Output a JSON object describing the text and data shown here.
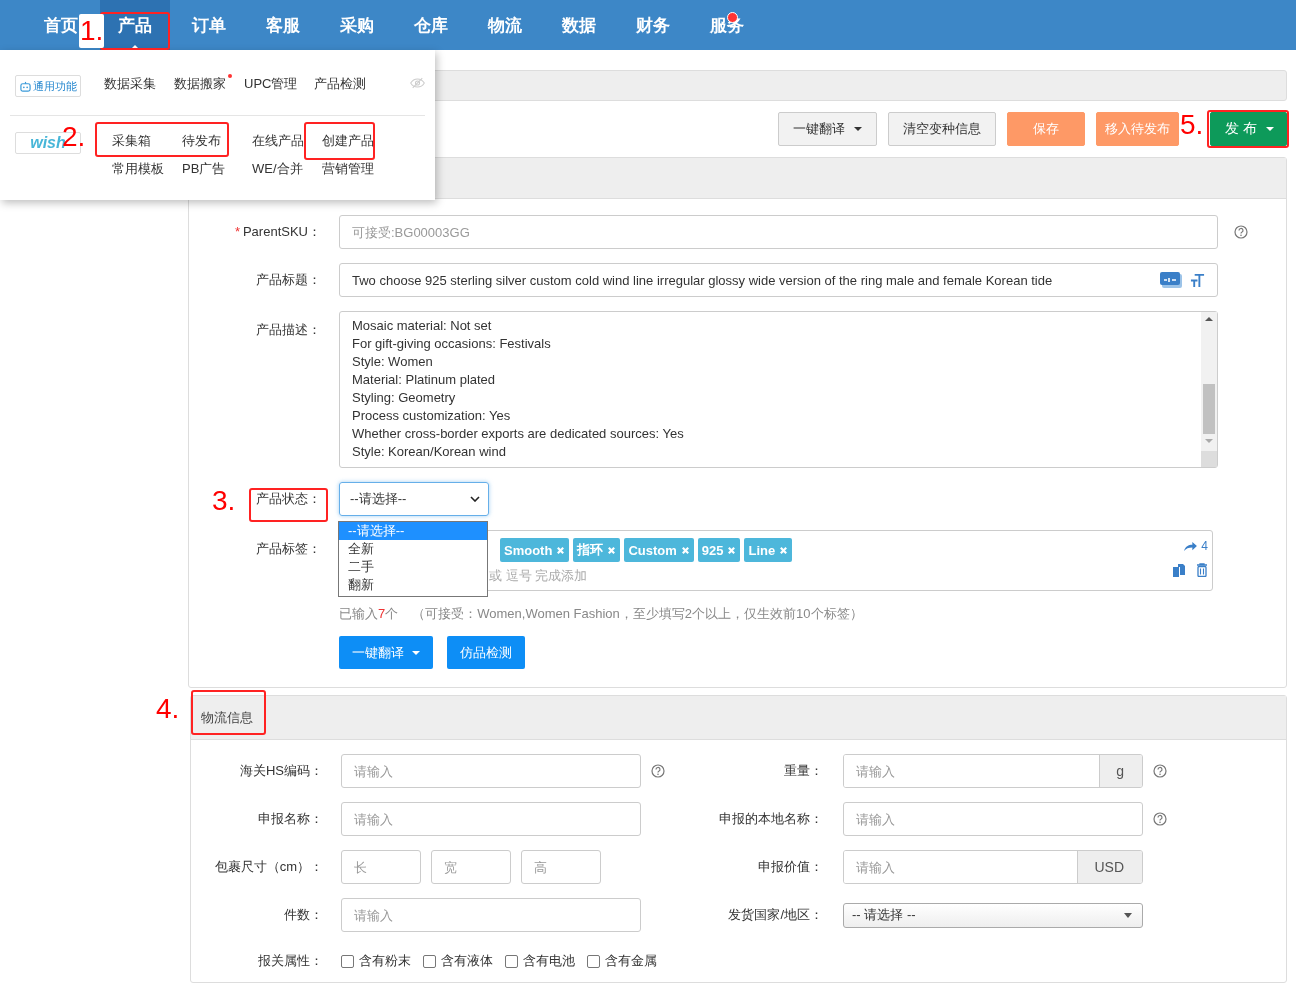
{
  "nav": {
    "items": [
      {
        "label": "首页",
        "selected": false,
        "dot": false
      },
      {
        "label": "产品",
        "selected": true,
        "dot": false
      },
      {
        "label": "订单",
        "selected": false,
        "dot": false
      },
      {
        "label": "客服",
        "selected": false,
        "dot": false
      },
      {
        "label": "采购",
        "selected": false,
        "dot": false
      },
      {
        "label": "仓库",
        "selected": false,
        "dot": false
      },
      {
        "label": "物流",
        "selected": false,
        "dot": false
      },
      {
        "label": "数据",
        "selected": false,
        "dot": false
      },
      {
        "label": "财务",
        "selected": false,
        "dot": false
      },
      {
        "label": "服务",
        "selected": false,
        "dot": true
      }
    ]
  },
  "menu": {
    "sections": [
      {
        "kind": "general",
        "badge": "通用功能",
        "items": [
          {
            "label": "数据采集",
            "dot": false
          },
          {
            "label": "数据搬家",
            "dot": true
          },
          {
            "label": "UPC管理",
            "dot": false
          },
          {
            "label": "产品检测",
            "dot": false
          }
        ]
      },
      {
        "kind": "wish",
        "badge": "wish",
        "items": [
          {
            "label": "采集箱",
            "dot": false
          },
          {
            "label": "待发布",
            "dot": false
          },
          {
            "label": "在线产品",
            "dot": false
          },
          {
            "label": "创建产品",
            "dot": false
          },
          {
            "label": "常用模板",
            "dot": false
          },
          {
            "label": "PB广告",
            "dot": false
          },
          {
            "label": "WE/合并",
            "dot": false
          },
          {
            "label": "营销管理",
            "dot": false
          }
        ]
      }
    ]
  },
  "toolbar": {
    "buttons": [
      {
        "label": "一键翻译",
        "kind": "default",
        "caret": true
      },
      {
        "label": "清空变种信息",
        "kind": "default",
        "caret": false
      },
      {
        "label": "保存",
        "kind": "warning",
        "caret": false
      },
      {
        "label": "移入待发布",
        "kind": "warning",
        "caret": false
      },
      {
        "label": "发 布",
        "kind": "success",
        "caret": true
      }
    ]
  },
  "product": {
    "parent_sku": {
      "required_mark": "*",
      "label": "ParentSKU：",
      "placeholder": "可接受:BG00003GG"
    },
    "title": {
      "label": "产品标题：",
      "value": "Two choose 925 sterling silver custom cold wind line irregular glossy wide version of the ring male and female Korean tide"
    },
    "description": {
      "label": "产品描述：",
      "lines": [
        "Mosaic material: Not set",
        "For gift-giving occasions: Festivals",
        "Style: Women",
        "Material: Platinum plated",
        "Styling: Geometry",
        "Process customization: Yes",
        "Whether cross-border exports are dedicated sources: Yes",
        "Style: Korean/Korean wind"
      ]
    },
    "status": {
      "label": "产品状态：",
      "value": "--请选择--",
      "options": [
        {
          "label": "--请选择--",
          "selected": true
        },
        {
          "label": "全新",
          "selected": false
        },
        {
          "label": "二手",
          "selected": false
        },
        {
          "label": "翻新",
          "selected": false
        }
      ]
    },
    "tags": {
      "label": "产品标签：",
      "items": [
        "Smooth",
        "指环",
        "Custom",
        "925",
        "Line"
      ],
      "placeholder": "或 逗号 完成添加",
      "share_count": "4",
      "count_prefix": "已输入",
      "count": "7",
      "count_suffix": "个",
      "note": "（可接受：Women,Women Fashion，至少填写2个以上，仅生效前10个标签）"
    },
    "buttons": [
      {
        "label": "一键翻译",
        "caret": true
      },
      {
        "label": "仿品检测",
        "caret": false
      }
    ]
  },
  "logistics": {
    "title": "物流信息",
    "left_fields": [
      {
        "kind": "input",
        "label": "海关HS编码：",
        "placeholder": "请输入",
        "help": true
      },
      {
        "kind": "input",
        "label": "申报名称：",
        "placeholder": "请输入",
        "help": false
      },
      {
        "kind": "dims",
        "label": "包裹尺寸（cm）：",
        "placeholders": [
          "长",
          "宽",
          "高"
        ]
      },
      {
        "kind": "input",
        "label": "件数：",
        "placeholder": "请输入",
        "help": false
      },
      {
        "kind": "checks",
        "label": "报关属性：",
        "options": [
          {
            "label": "含有粉末",
            "checked": false
          },
          {
            "label": "含有液体",
            "checked": false
          },
          {
            "label": "含有电池",
            "checked": false
          },
          {
            "label": "含有金属",
            "checked": false
          }
        ]
      }
    ],
    "right_fields": [
      {
        "kind": "input",
        "label": "重量：",
        "placeholder": "请输入",
        "addon": "g",
        "help": true
      },
      {
        "kind": "input",
        "label": "申报的本地名称：",
        "placeholder": "请输入",
        "help": true
      },
      {
        "kind": "input",
        "label": "申报价值：",
        "placeholder": "请输入",
        "addon": "USD",
        "help": false
      },
      {
        "kind": "select",
        "label": "发货国家/地区：",
        "value": "-- 请选择 --"
      }
    ]
  },
  "annotations": [
    {
      "kind": "numbered",
      "label": "1."
    },
    {
      "kind": "numbered",
      "label": "2."
    },
    {
      "kind": "plain"
    },
    {
      "kind": "numbered",
      "label": "3."
    },
    {
      "kind": "numbered",
      "label": "4."
    },
    {
      "kind": "numbered",
      "label": "5."
    }
  ]
}
